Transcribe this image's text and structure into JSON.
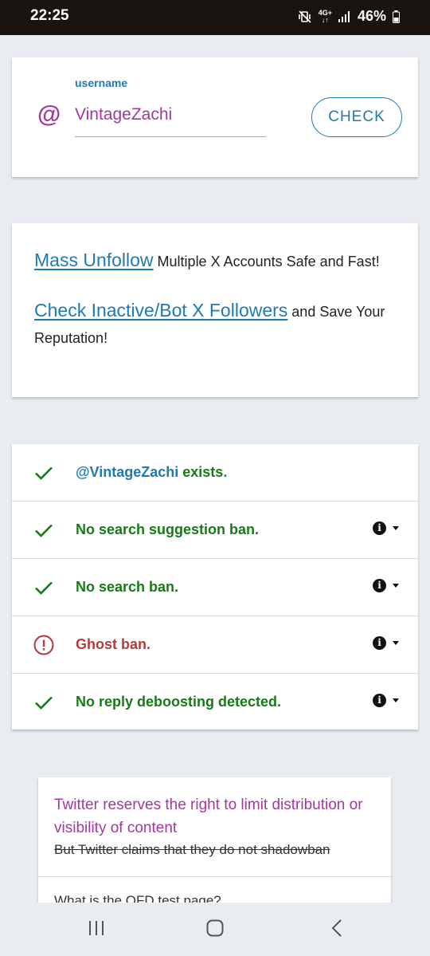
{
  "status_bar": {
    "time": "22:25",
    "network": "4G+",
    "battery": "46%",
    "icons": [
      "mute-vibrate-icon",
      "mobile-data-icon",
      "signal-icon",
      "battery-icon"
    ]
  },
  "username_card": {
    "label": "username",
    "at_symbol": "@",
    "value": "VintageZachi",
    "button": "CHECK"
  },
  "promo": {
    "line1_link": "Mass Unfollow",
    "line1_text": " Multiple X Accounts Safe and Fast!",
    "line2_link": "Check Inactive/Bot X Followers",
    "line2_text": " and Save Your Reputation!"
  },
  "results": [
    {
      "status": "ok",
      "handle": "@VintageZachi",
      "text": " exists",
      "suffix": ".",
      "has_info": false
    },
    {
      "status": "ok",
      "handle": "",
      "text": "No search suggestion ban.",
      "suffix": "",
      "has_info": true
    },
    {
      "status": "ok",
      "handle": "",
      "text": "No search ban.",
      "suffix": "",
      "has_info": true
    },
    {
      "status": "warn",
      "handle": "",
      "text": "Ghost ban.",
      "suffix": "",
      "has_info": true
    },
    {
      "status": "ok",
      "handle": "",
      "text": "No reply deboosting detected.",
      "suffix": "",
      "has_info": true
    }
  ],
  "info_card": {
    "title": "Twitter reserves the right to limit distribution or visibility of content",
    "strike": "But Twitter claims that they do not shadowban",
    "question": "What is the QFD test page?"
  },
  "colors": {
    "accent_purple": "#a3389e",
    "link_blue": "#1f7ab3",
    "ok_green": "#177a17",
    "warn_red": "#b23b3b",
    "background": "#e9edf1"
  }
}
